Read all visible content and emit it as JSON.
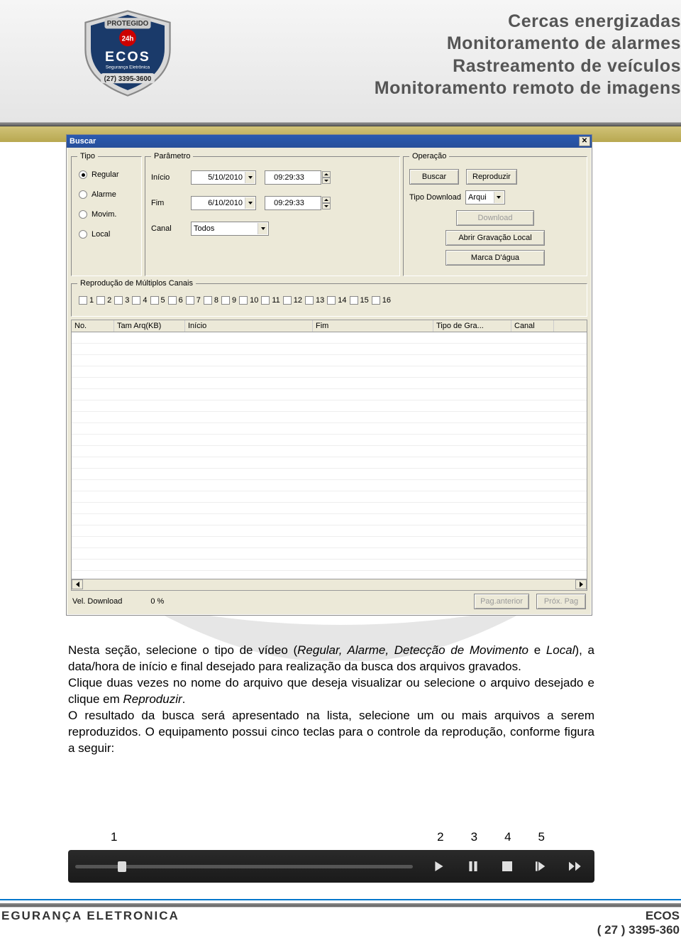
{
  "header": {
    "lines": [
      "Cercas energizadas",
      "Monitoramento de alarmes",
      "Rastreamento de veículos",
      "Monitoramento remoto de imagens"
    ],
    "logo_top": "PROTEGIDO",
    "logo_24h": "24h",
    "logo_brand": "ECOS",
    "logo_sub": "Segurança Eletrônica",
    "logo_phone": "(27) 3395-3600"
  },
  "dialog": {
    "title": "Buscar",
    "tipo": {
      "legend": "Tipo",
      "options": [
        "Regular",
        "Alarme",
        "Movim.",
        "Local"
      ],
      "selected": "Regular"
    },
    "param": {
      "legend": "Parâmetro",
      "inicio_label": "Início",
      "inicio_date": "5/10/2010",
      "inicio_time": "09:29:33",
      "fim_label": "Fim",
      "fim_date": "6/10/2010",
      "fim_time": "09:29:33",
      "canal_label": "Canal",
      "canal_value": "Todos"
    },
    "op": {
      "legend": "Operação",
      "buscar": "Buscar",
      "reproduzir": "Reproduzir",
      "tipo_download_label": "Tipo Download",
      "tipo_download_value": "Arqui",
      "download": "Download",
      "abrir": "Abrir Gravação Local",
      "marca": "Marca D'água"
    },
    "multi": {
      "legend": "Reprodução de Múltiplos Canais",
      "channels": [
        "1",
        "2",
        "3",
        "4",
        "5",
        "6",
        "7",
        "8",
        "9",
        "10",
        "11",
        "12",
        "13",
        "14",
        "15",
        "16"
      ]
    },
    "table": {
      "columns": [
        "No.",
        "Tam Arq(KB)",
        "Início",
        "Fim",
        "Tipo de Gra...",
        "Canal"
      ]
    },
    "footer": {
      "vel_label": "Vel. Download",
      "vel_value": "0 %",
      "prev": "Pag.anterior",
      "next": "Próx. Pag"
    }
  },
  "body_text": {
    "p1a": "Nesta seção, selecione o tipo de vídeo (",
    "p1b": "Regular, Alarme, Detecção de Movimento",
    "p1c": " e ",
    "p1d": "Local",
    "p1e": "), a data/hora de início e final desejado para realização da busca dos arquivos gravados.",
    "p2a": "Clique duas vezes no nome do arquivo que deseja visualizar ou selecione o arquivo desejado e clique em ",
    "p2b": "Reproduzir",
    "p2c": ".",
    "p3": "O resultado da busca será apresentado na lista, selecione um ou mais arquivos a serem reproduzidos. O equipamento possui cinco teclas para o controle da reprodução, conforme figura a seguir:"
  },
  "numbers": [
    "1",
    "2",
    "3",
    "4",
    "5"
  ],
  "footer": {
    "left": "EGURANÇA ELETRONICA",
    "right1": "ECOS",
    "right2": "( 27 ) 3395-360"
  }
}
